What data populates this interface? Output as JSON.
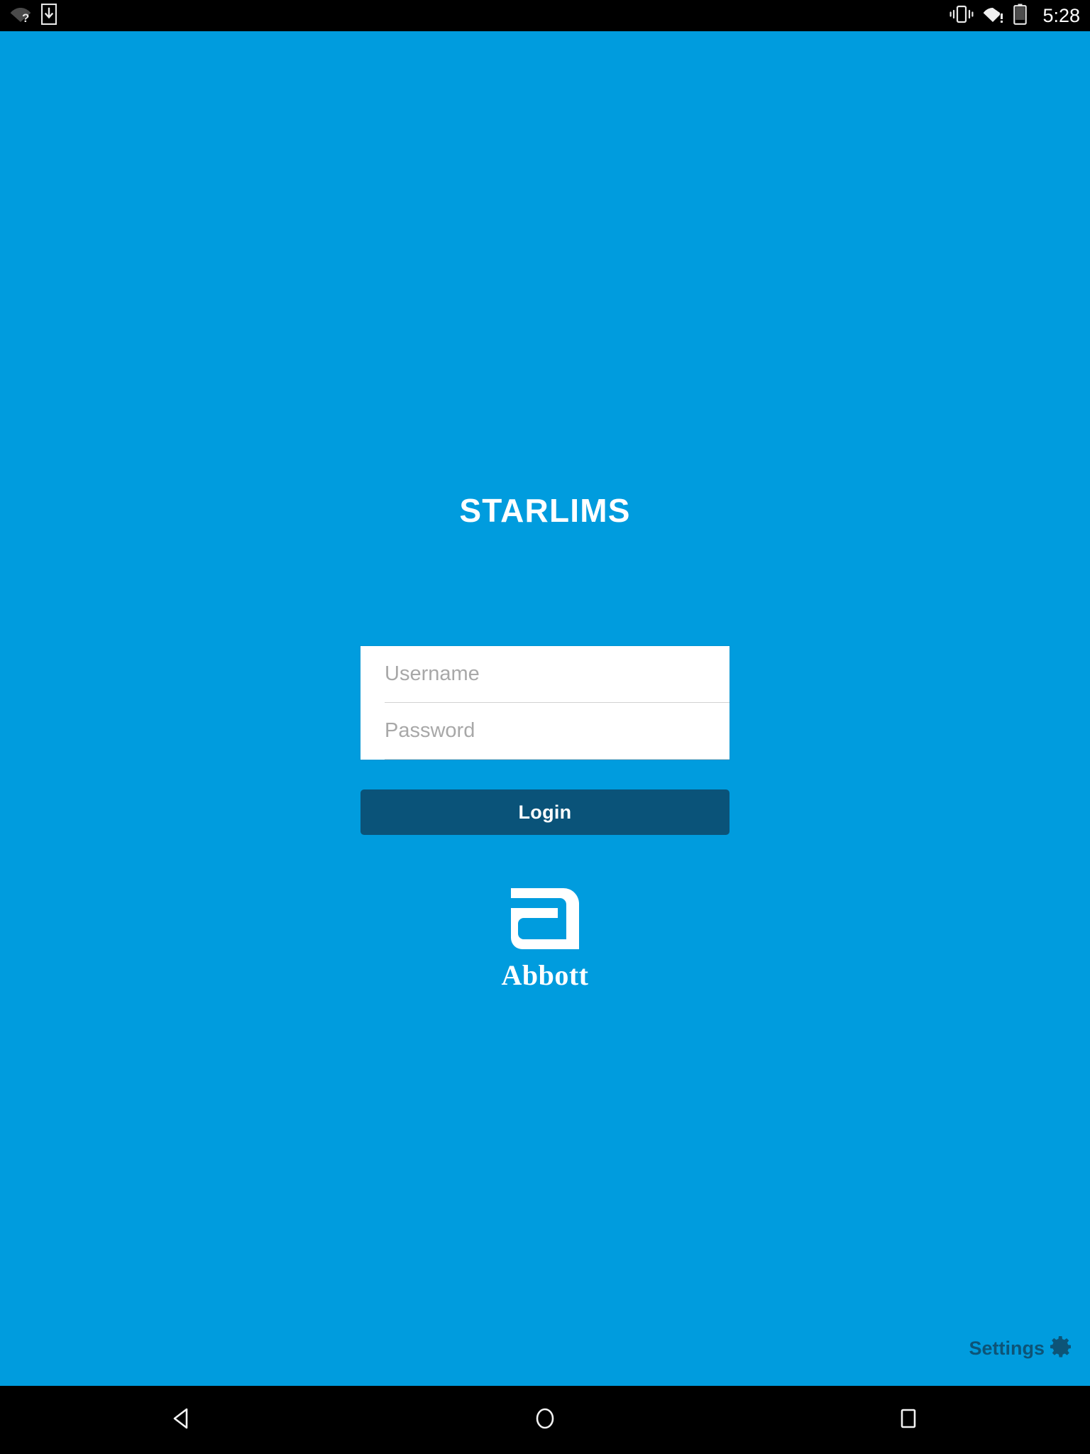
{
  "status_bar": {
    "icons_left": [
      {
        "name": "wifi-unknown-icon",
        "label": "wifi-question"
      },
      {
        "name": "download-icon",
        "label": "download"
      }
    ],
    "icons_right": [
      {
        "name": "vibrate-icon",
        "label": "vibrate"
      },
      {
        "name": "wifi-warning-icon",
        "label": "wifi-exclamation"
      },
      {
        "name": "battery-icon",
        "label": "battery-low"
      }
    ],
    "clock": "5:28"
  },
  "app": {
    "title": "STARLIMS",
    "background_color": "#009CDE",
    "accent_color": "#0A5379"
  },
  "login": {
    "username": {
      "placeholder": "Username",
      "value": ""
    },
    "password": {
      "placeholder": "Password",
      "value": ""
    },
    "submit_label": "Login"
  },
  "brand": {
    "mark_name": "abbott-a-logo",
    "wordmark": "Abbott",
    "color": "#FFFFFF"
  },
  "settings": {
    "label": "Settings",
    "icon": "gear-icon",
    "color": "#0D5477"
  },
  "nav_bar": {
    "buttons": [
      {
        "name": "back-button",
        "icon": "triangle-left-icon"
      },
      {
        "name": "home-button",
        "icon": "circle-icon"
      },
      {
        "name": "recents-button",
        "icon": "square-icon"
      }
    ]
  }
}
